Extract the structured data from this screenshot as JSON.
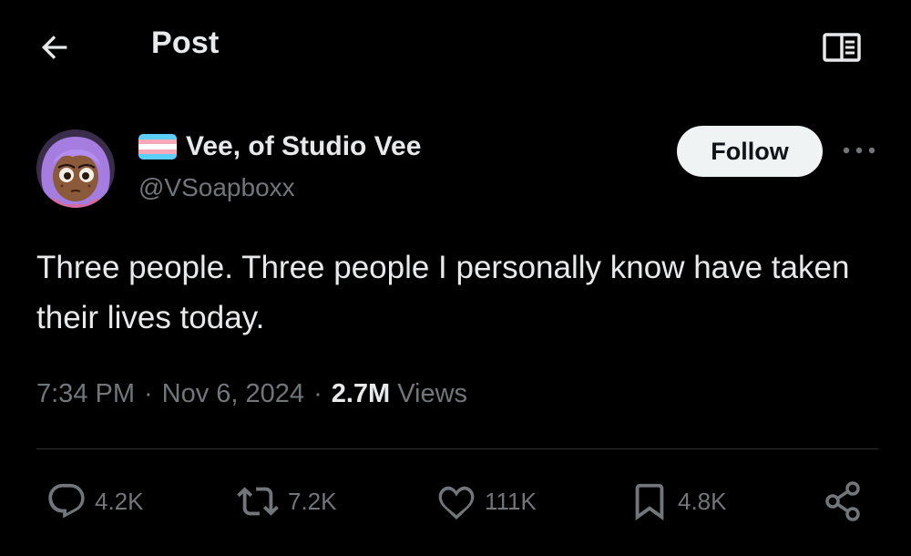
{
  "header": {
    "back_icon": "arrow-left-icon",
    "title": "Post",
    "reader_icon": "open-book-icon"
  },
  "author": {
    "display_name": "Vee, of Studio Vee",
    "handle": "@VSoapboxx",
    "flag_icon": "transgender-flag-icon",
    "flag_colors": [
      "#5BCEFA",
      "#F5A9B8",
      "#FFFFFF",
      "#F5A9B8",
      "#5BCEFA"
    ],
    "avatar_icon": "cartoon-avatar"
  },
  "follow_label": "Follow",
  "more_icon": "more-dots-icon",
  "tweet": {
    "text": "Three people. Three people I personally know have taken their lives today."
  },
  "meta": {
    "time": "7:34 PM",
    "date": "Nov 6, 2024",
    "separator": "·",
    "views_count": "2.7M",
    "views_label": "Views"
  },
  "actions": {
    "replies": "4.2K",
    "reposts": "7.2K",
    "likes": "111K",
    "bookmarks": "4.8K"
  },
  "colors": {
    "background": "#000000",
    "text_primary": "#e7e9ea",
    "text_secondary": "#71767b",
    "divider": "#2f3336",
    "follow_bg": "#eff3f4"
  }
}
